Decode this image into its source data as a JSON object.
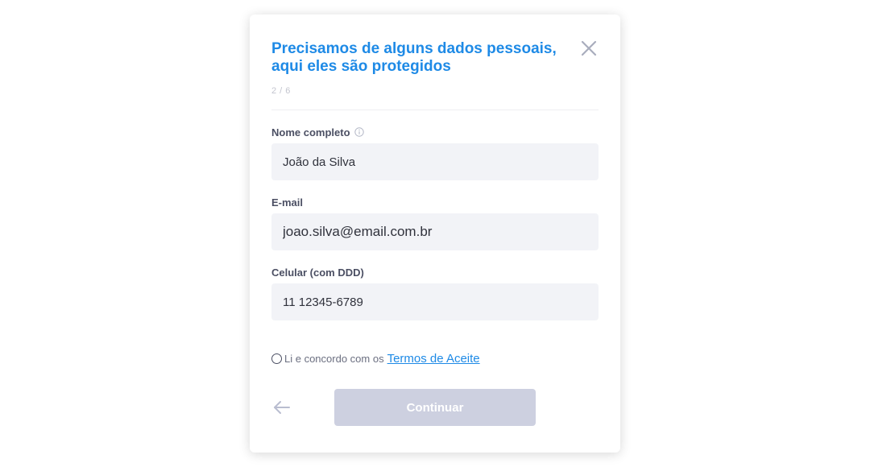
{
  "modal": {
    "title": "Precisamos de alguns dados pessoais, aqui eles são protegidos",
    "step": "2 / 6",
    "close_icon": "close-icon"
  },
  "form": {
    "fields": [
      {
        "label": "Nome completo",
        "value": "João da Silva",
        "has_info_icon": true
      },
      {
        "label": "E-mail",
        "value": "joao.silva@email.com.br"
      },
      {
        "label": "Celular (com DDD)",
        "value": "11 12345-6789"
      }
    ],
    "terms_text": "Li e concordo com os",
    "terms_link": "Termos de Aceite"
  },
  "footer": {
    "back_icon": "arrow-left-icon",
    "continue_label": "Continuar"
  },
  "colors": {
    "accent": "#1e8ae6",
    "input_bg": "#f2f3f7",
    "button_disabled": "#cdd0e0"
  }
}
